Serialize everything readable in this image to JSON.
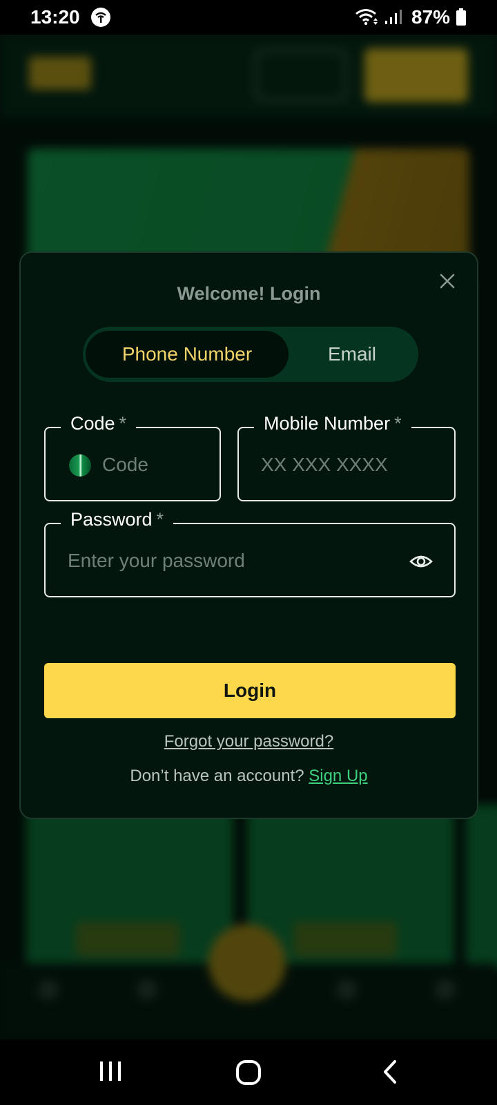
{
  "status_bar": {
    "time": "13:20",
    "battery": "87%",
    "icons": [
      "app-notification-icon",
      "wifi-icon",
      "signal-icon",
      "battery-icon"
    ]
  },
  "modal": {
    "title": "Welcome! Login",
    "tabs": {
      "phone": "Phone Number",
      "email": "Email",
      "active": "phone"
    },
    "code_field": {
      "label": "Code",
      "required_mark": "*",
      "placeholder": "Code",
      "value": ""
    },
    "mobile_field": {
      "label": "Mobile Number",
      "required_mark": "*",
      "placeholder": "XX XXX XXXX",
      "value": ""
    },
    "password_field": {
      "label": "Password",
      "required_mark": "*",
      "placeholder": "Enter your password",
      "value": ""
    },
    "login_button": "Login",
    "forgot_password": "Forgot your password?",
    "no_account_text": "Don’t have an account?",
    "sign_up_link": "Sign Up"
  },
  "colors": {
    "accent_yellow": "#fdd84a",
    "link_green": "#3ed07e",
    "modal_bg": "#03160d",
    "active_tab_text": "#f2d46a"
  }
}
